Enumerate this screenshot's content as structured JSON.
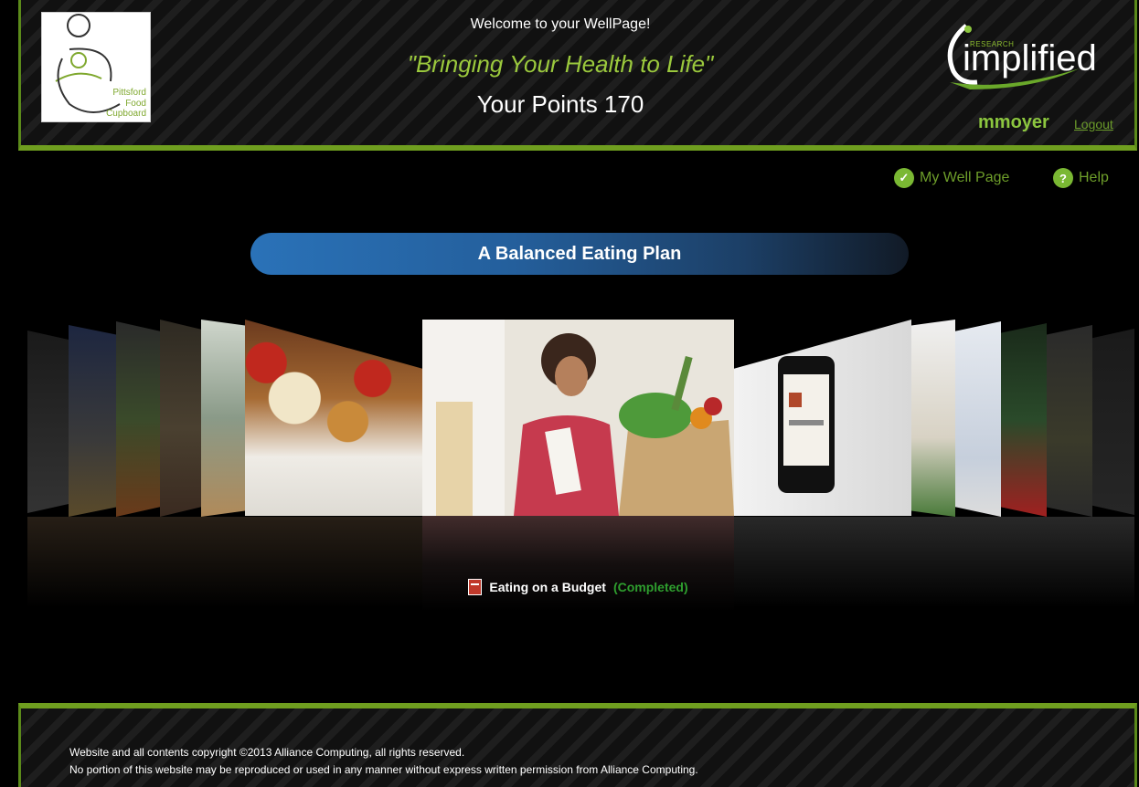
{
  "header": {
    "logo_left_text": [
      "Pittsford",
      "Food",
      "Cupboard"
    ],
    "welcome": "Welcome to your WellPage!",
    "slogan": "\"Bringing Your Health to Life\"",
    "points": "Your Points 170",
    "brand_small": "RESEARCH",
    "brand_word": "implified",
    "username": "mmoyer",
    "logout": "Logout"
  },
  "nav": {
    "my_well_page": "My Well Page",
    "help": "Help"
  },
  "section": {
    "title": "A Balanced Eating Plan"
  },
  "carousel": {
    "current_title": "Eating on a Budget",
    "current_status": "(Completed)"
  },
  "footer": {
    "line1": "Website and all contents copyright ©2013 Alliance Computing, all rights reserved.",
    "line2": "No portion of this website may be reproduced or used in any manner without express written permission from Alliance Computing."
  },
  "colors": {
    "accent_green": "#8cc63f",
    "section_blue": "#2a72b8"
  }
}
